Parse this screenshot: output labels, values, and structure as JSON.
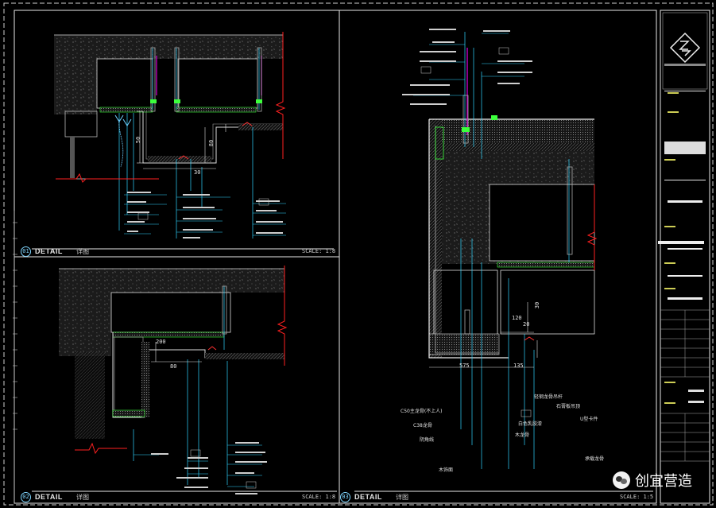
{
  "details": [
    {
      "number": "01",
      "title": "DETAIL",
      "subtitle": "详图",
      "scale": "SCALE: 1:8"
    },
    {
      "number": "02",
      "title": "DETAIL",
      "subtitle": "详图",
      "scale": "SCALE: 1:8"
    },
    {
      "number": "03",
      "title": "DETAIL",
      "subtitle": "详图",
      "scale": "SCALE: 1:5"
    }
  ],
  "dimensions": {
    "d1a": "50",
    "d1b": "30",
    "d1c": "80",
    "d2a": "80",
    "d2b": "200",
    "d3a": "20",
    "d3b": "120",
    "d3c": "30",
    "d3d": "575",
    "d3e": "135"
  },
  "annotations_detail3": {
    "a1": "轻钢龙骨吊杆",
    "a2": "石膏板吊顶",
    "a3": "木饰面",
    "a4": "C50主龙骨(不上人)",
    "a5": "U型卡件",
    "a6": "白色乳胶漆",
    "a7": "阴角线",
    "a8": "C38龙骨",
    "a9": "承载龙骨",
    "a10": "木龙骨"
  },
  "watermark": {
    "text": "创宜营造"
  },
  "colors": {
    "frame": "#e8e8e8",
    "leader": "#2fd4ff",
    "break_line": "#ff2020",
    "hatch": "#7a7a7a",
    "accent_green": "#3cff3c",
    "accent_magenta": "#d400d4"
  }
}
